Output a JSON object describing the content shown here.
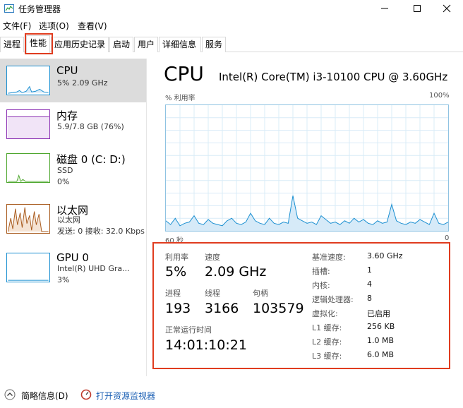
{
  "window": {
    "title": "任务管理器"
  },
  "menu": {
    "file": "文件(F)",
    "options": "选项(O)",
    "view": "查看(V)"
  },
  "tabs": [
    "进程",
    "性能",
    "应用历史记录",
    "启动",
    "用户",
    "详细信息",
    "服务"
  ],
  "sidebar": {
    "items": [
      {
        "name": "CPU",
        "lines": [
          "5% 2.09 GHz"
        ],
        "color": "#1a8fd1"
      },
      {
        "name": "内存",
        "lines": [
          "5.9/7.8 GB (76%)"
        ],
        "color": "#8b2fb3"
      },
      {
        "name": "磁盘 0 (C: D:)",
        "lines": [
          "SSD",
          "0%"
        ],
        "color": "#4ea72e"
      },
      {
        "name": "以太网",
        "lines": [
          "以太网",
          "发送: 0 接收: 32.0 Kbps"
        ],
        "color": "#a7581a"
      },
      {
        "name": "GPU 0",
        "lines": [
          "Intel(R) UHD Gra...",
          "3%"
        ],
        "color": "#1a8fd1"
      }
    ]
  },
  "main": {
    "title": "CPU",
    "model": "Intel(R) Core(TM) i3-10100 CPU @ 3.60GHz",
    "chart_top_left": "% 利用率",
    "chart_top_right": "100%",
    "chart_bottom_left": "60 秒",
    "chart_bottom_right": "0"
  },
  "chart_data": {
    "type": "area",
    "ylim": [
      0,
      100
    ],
    "x_label": "60 秒",
    "series": [
      {
        "values": [
          8,
          5,
          10,
          4,
          6,
          7,
          12,
          6,
          5,
          9,
          6,
          5,
          4,
          8,
          10,
          6,
          5,
          7,
          14,
          8,
          6,
          5,
          10,
          6,
          5,
          7,
          6,
          28,
          10,
          8,
          6,
          7,
          5,
          12,
          9,
          6,
          7,
          5,
          8,
          6,
          10,
          7,
          9,
          6,
          5,
          8,
          6,
          7,
          21,
          8,
          6,
          5,
          7,
          6,
          9,
          7,
          5,
          14,
          6,
          5,
          7
        ]
      }
    ]
  },
  "stats": {
    "utilization_label": "利用率",
    "utilization": "5%",
    "speed_label": "速度",
    "speed": "2.09 GHz",
    "processes_label": "进程",
    "processes": "193",
    "threads_label": "线程",
    "threads": "3166",
    "handles_label": "句柄",
    "handles": "103579",
    "uptime_label": "正常运行时间",
    "uptime": "14:01:10:21",
    "details": [
      {
        "label": "基准速度:",
        "value": "3.60 GHz"
      },
      {
        "label": "插槽:",
        "value": "1"
      },
      {
        "label": "内核:",
        "value": "4"
      },
      {
        "label": "逻辑处理器:",
        "value": "8"
      },
      {
        "label": "虚拟化:",
        "value": "已启用"
      },
      {
        "label": "L1 缓存:",
        "value": "256 KB"
      },
      {
        "label": "L2 缓存:",
        "value": "1.0 MB"
      },
      {
        "label": "L3 缓存:",
        "value": "6.0 MB"
      }
    ]
  },
  "footer": {
    "brief": "简略信息(D)",
    "resmon": "打开资源监视器"
  },
  "colors": {
    "highlight": "#e03c1f",
    "cpu": "#1a8fd1",
    "selected_bg": "#dcdcdc"
  }
}
